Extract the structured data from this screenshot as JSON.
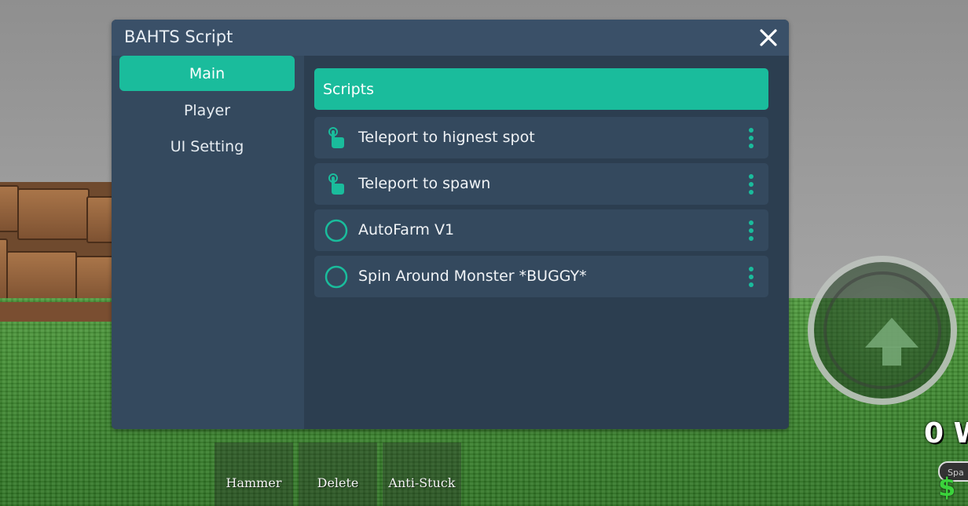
{
  "window": {
    "title": "BAHTS Script"
  },
  "sidebar": {
    "items": [
      {
        "label": "Main",
        "active": true
      },
      {
        "label": "Player",
        "active": false
      },
      {
        "label": "UI Setting",
        "active": false
      }
    ]
  },
  "main": {
    "section_title": "Scripts",
    "rows": [
      {
        "label": "Teleport to hignest spot",
        "icon": "tap-icon"
      },
      {
        "label": "Teleport to spawn",
        "icon": "tap-icon"
      },
      {
        "label": "AutoFarm V1",
        "icon": "toggle-circle-icon"
      },
      {
        "label": "Spin Around Monster *BUGGY*",
        "icon": "toggle-circle-icon"
      }
    ]
  },
  "toolbar": {
    "items": [
      "Hammer",
      "Delete",
      "Anti-Stuck"
    ]
  },
  "hud": {
    "money_text": "0 W",
    "spawn_label": "Spa",
    "currency_symbol": "$"
  },
  "colors": {
    "accent": "#1abc9c",
    "window_bg": "#2c3e50",
    "panel_bg": "#34495e",
    "titlebar_bg": "#3a5068"
  }
}
